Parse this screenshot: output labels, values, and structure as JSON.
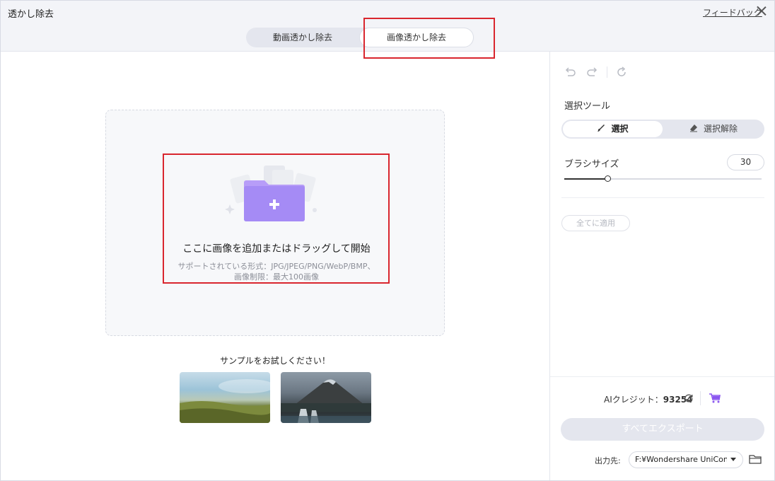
{
  "header": {
    "app_title": "透かし除去",
    "feedback": "フィードバック",
    "tabs": [
      {
        "label": "動画透かし除去",
        "active": false
      },
      {
        "label": "画像透かし除去",
        "active": true
      }
    ]
  },
  "dropzone": {
    "title": "ここに画像を追加またはドラッグして開始",
    "formats": "サポートされている形式：JPG/JPEG/PNG/WebP/BMP、",
    "limit": "画像制限：最大100画像"
  },
  "samples": {
    "title": "サンプルをお試しください！",
    "items": [
      "sample-landscape-grass",
      "sample-mountain-waterfall"
    ]
  },
  "panel": {
    "select_tool_label": "選択ツール",
    "select_label": "選択",
    "deselect_label": "選択解除",
    "brush_size_label": "ブラシサイズ",
    "brush_size_value": "30",
    "brush_size_fraction": 0.22,
    "apply_all": "全てに適用",
    "credit_label": "AIクレジット：",
    "credit_value": "93254",
    "export_all": "すべてエクスポート",
    "output_label": "出力先:",
    "output_path": "F:¥Wondershare UniCon"
  },
  "colors": {
    "accent_purple": "#a58bf5",
    "highlight_red": "#d9262e",
    "cart_purple": "#8a55f0"
  }
}
